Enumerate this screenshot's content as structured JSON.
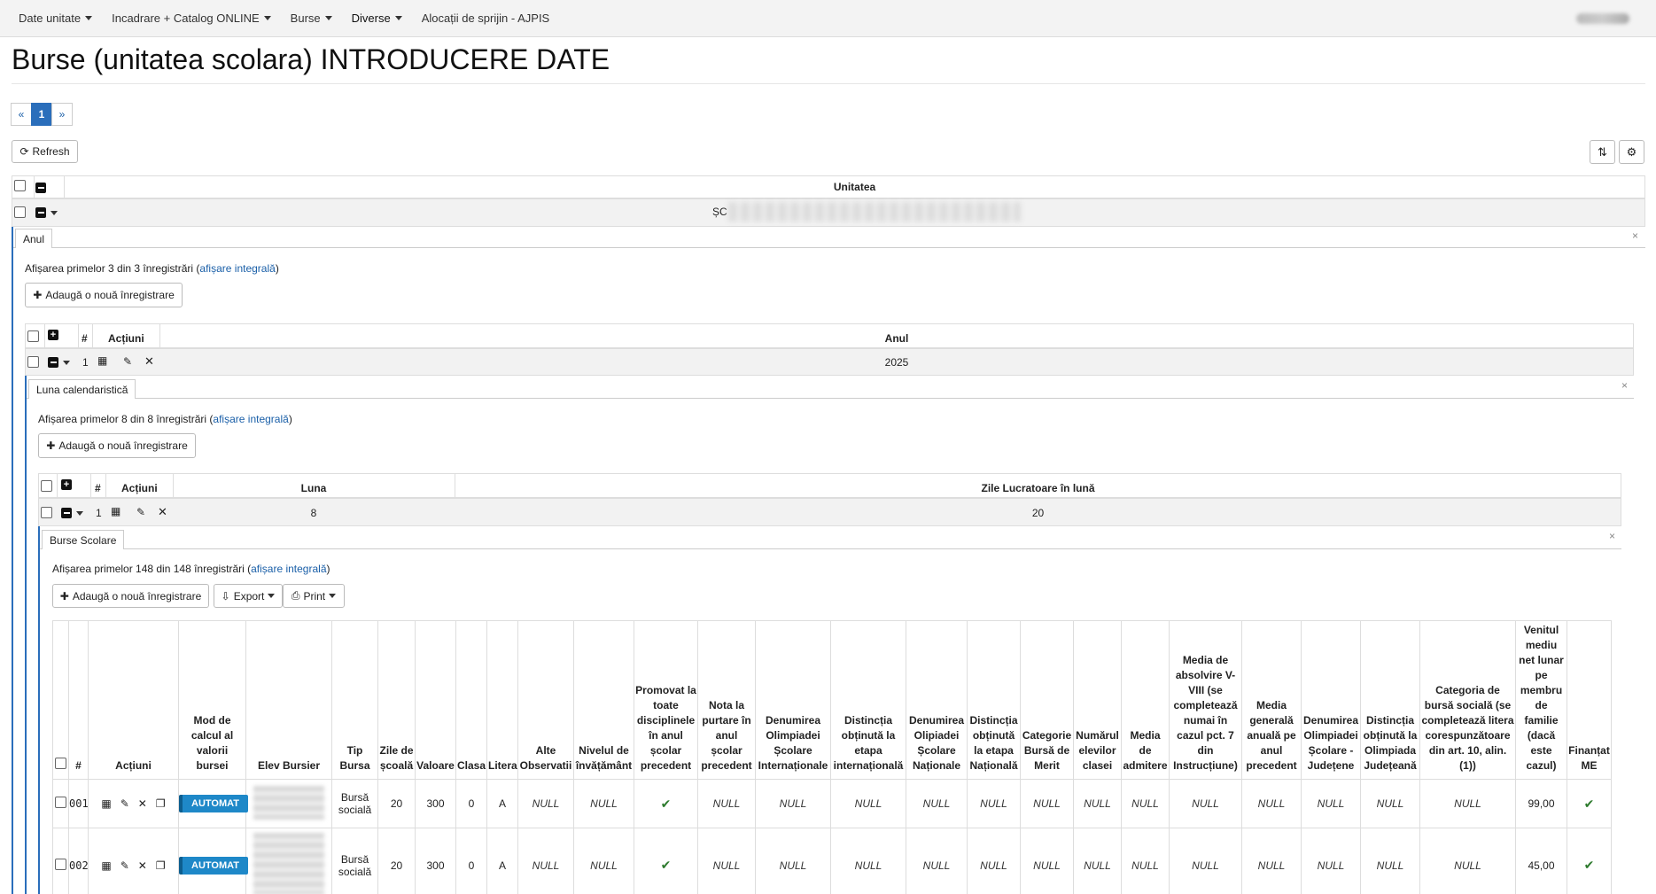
{
  "nav": {
    "items": [
      "Date unitate",
      "Incadrare + Catalog ONLINE",
      "Burse",
      "Diverse",
      "Alocații de sprijin - AJPIS"
    ]
  },
  "page": {
    "title": "Burse (unitatea scolara) INTRODUCERE DATE",
    "pager_prev": "«",
    "pager_current": "1",
    "pager_next": "»",
    "refresh": "Refresh"
  },
  "unitate": {
    "header": "Unitatea",
    "value_prefix": "ȘC"
  },
  "anul": {
    "tab": "Anul",
    "info_prefix": "Afișarea primelor 3 din 3 înregistrări (",
    "info_link": "afișare integrală",
    "info_suffix": ")",
    "add": "Adaugă o nouă înregistrare",
    "col_hash": "#",
    "col_actions": "Acțiuni",
    "col_anul": "Anul",
    "row_num": "1",
    "row_value": "2025"
  },
  "luna": {
    "tab": "Luna calendaristică",
    "info_prefix": "Afișarea primelor 8 din 8 înregistrări (",
    "info_link": "afișare integrală",
    "info_suffix": ")",
    "add": "Adaugă o nouă înregistrare",
    "col_hash": "#",
    "col_actions": "Acțiuni",
    "col_luna": "Luna",
    "col_zile": "Zile Lucratoare în lună",
    "row_num": "1",
    "row_luna": "8",
    "row_zile": "20"
  },
  "burse": {
    "tab": "Burse Scolare",
    "info_prefix": "Afișarea primelor 148 din 148 înregistrări (",
    "info_link": "afișare integrală",
    "info_suffix": ")",
    "add": "Adaugă o nouă înregistrare",
    "export": "Export",
    "print": "Print",
    "headers": [
      "#",
      "Acțiuni",
      "Mod de calcul al valorii bursei",
      "Elev Bursier",
      "Tip Bursa",
      "Zile de școală",
      "Valoare",
      "Clasa",
      "Litera",
      "Alte Observatii",
      "Nivelul de învățământ",
      "Promovat la toate disciplinele în anul școlar precedent",
      "Nota la purtare în anul școlar precedent",
      "Denumirea Olimpiadei Școlare Internaționale",
      "Distincția obținută la etapa internațională",
      "Denumirea Olipiadei Școlare Naționale",
      "Distincția obținută la etapa Națională",
      "Categorie Bursă de Merit",
      "Numărul elevilor clasei",
      "Media de admitere",
      "Media de absolvire V-VIII (se completează numai în cazul pct. 7 din Instrucțiune)",
      "Media generală anuală pe anul precedent",
      "Denumirea Olimpiadei Școlare - Județene",
      "Distincția obținută la Olimpiada Județeană",
      "Categoria de bursă socială (se completează litera corespunzătoare din art. 10, alin. (1))",
      "Venitul mediu net lunar pe membru de familie (dacă este cazul)",
      "Finanțat ME"
    ],
    "rows": [
      {
        "num": "001",
        "mod": "AUTOMAT",
        "tip": "Bursă socială",
        "zile": "20",
        "valoare": "300",
        "clasa": "0",
        "litera": "A",
        "null": "NULL",
        "venit": "99,00"
      },
      {
        "num": "002",
        "mod": "AUTOMAT",
        "tip": "Bursă socială",
        "zile": "20",
        "valoare": "300",
        "clasa": "0",
        "litera": "A",
        "null": "NULL",
        "venit": "45,00"
      }
    ]
  },
  "colors": {
    "accent": "#2a6ebb",
    "automat": "#1e88c8",
    "check": "#2d7a2d"
  }
}
